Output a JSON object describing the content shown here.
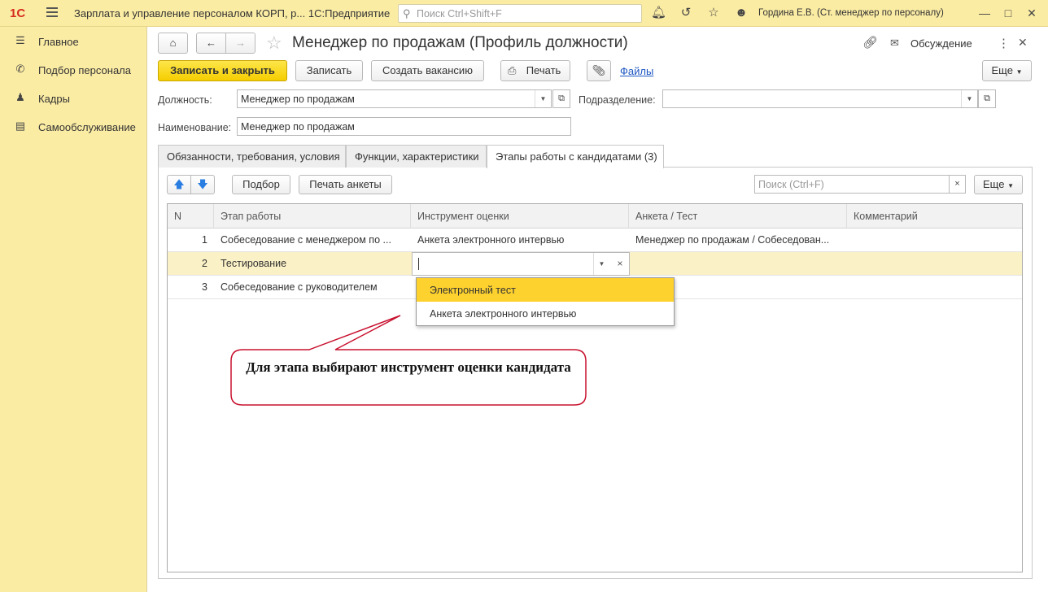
{
  "titlebar": {
    "logo": "1С",
    "title": "Зарплата и управление персоналом КОРП, р...  1С:Предприятие",
    "search_placeholder": "Поиск Ctrl+Shift+F",
    "user": "Гордина Е.В. (Ст. менеджер по персоналу)"
  },
  "sidebar": {
    "items": [
      {
        "label": "Главное",
        "icon": "menu-icon"
      },
      {
        "label": "Подбор персонала",
        "icon": "phone-icon"
      },
      {
        "label": "Кадры",
        "icon": "people-icon"
      },
      {
        "label": "Самообслуживание",
        "icon": "id-card-icon"
      }
    ]
  },
  "form": {
    "title": "Менеджер по продажам (Профиль должности)",
    "discussion_label": "Обсуждение",
    "toolbar": {
      "save_close": "Записать и закрыть",
      "save": "Записать",
      "create_vacancy": "Создать вакансию",
      "print": "Печать",
      "files": "Файлы",
      "more": "Еще"
    },
    "position_label": "Должность:",
    "position_value": "Менеджер по продажам",
    "department_label": "Подразделение:",
    "department_value": "",
    "name_label": "Наименование:",
    "name_value": "Менеджер по продажам"
  },
  "tabs": [
    {
      "label": "Обязанности, требования, условия",
      "active": false
    },
    {
      "label": "Функции, характеристики",
      "active": false
    },
    {
      "label": "Этапы работы с кандидатами (3)",
      "active": true
    }
  ],
  "stages_toolbar": {
    "pick": "Подбор",
    "print_forms": "Печать анкеты",
    "search_placeholder": "Поиск (Ctrl+F)",
    "more": "Еще"
  },
  "grid": {
    "columns": [
      "N",
      "Этап работы",
      "Инструмент оценки",
      "Анкета / Тест",
      "Комментарий"
    ],
    "rows": [
      {
        "n": "1",
        "stage": "Собеседование с менеджером по ...",
        "tool": "Анкета электронного интервью",
        "form": "Менеджер по продажам / Собеседован...",
        "comment": ""
      },
      {
        "n": "2",
        "stage": "Тестирование",
        "tool": "",
        "form": "",
        "comment": ""
      },
      {
        "n": "3",
        "stage": "Собеседование с руководителем",
        "tool": "",
        "form": "",
        "comment": ""
      }
    ]
  },
  "dropdown": {
    "options": [
      "Электронный тест",
      "Анкета электронного интервью"
    ],
    "highlighted": 0
  },
  "callout": {
    "text": "Для этапа выбирают инструмент оценки кандидата",
    "border_color": "#c8102e"
  },
  "colors": {
    "accent_yellow": "#fbeca4",
    "primary_button": "#f5cd00",
    "selected_row": "#fbf1c6",
    "highlight": "#fdd12e",
    "link": "#1d56c2"
  }
}
